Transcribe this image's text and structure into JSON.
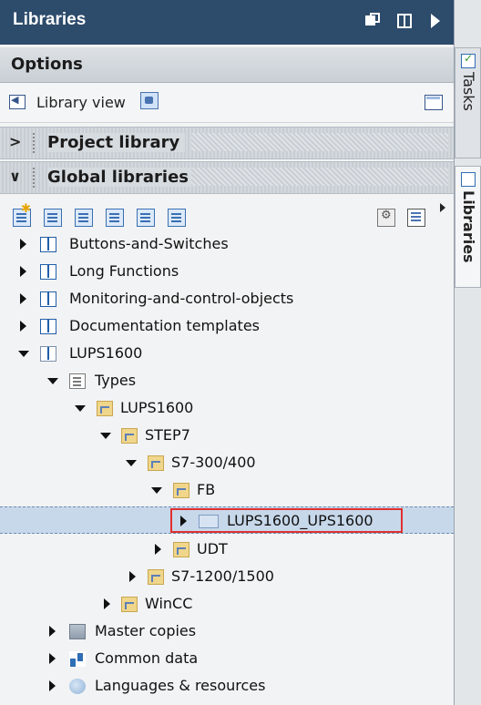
{
  "panel": {
    "title": "Libraries",
    "options_label": "Options",
    "library_view_label": "Library view",
    "project_library_label": "Project library",
    "global_libraries_label": "Global libraries"
  },
  "tree": [
    {
      "label": "Buttons-and-Switches"
    },
    {
      "label": "Long Functions"
    },
    {
      "label": "Monitoring-and-control-objects"
    },
    {
      "label": "Documentation templates"
    },
    {
      "label": "LUPS1600"
    },
    {
      "label": "Types"
    },
    {
      "label": "LUPS1600"
    },
    {
      "label": "STEP7"
    },
    {
      "label": "S7-300/400"
    },
    {
      "label": "FB"
    },
    {
      "label": "LUPS1600_UPS1600"
    },
    {
      "label": "UDT"
    },
    {
      "label": "S7-1200/1500"
    },
    {
      "label": "WinCC"
    },
    {
      "label": "Master copies"
    },
    {
      "label": "Common data"
    },
    {
      "label": "Languages & resources"
    }
  ],
  "right_tabs": {
    "tasks": "Tasks",
    "libraries": "Libraries"
  },
  "colors": {
    "title_bar": "#2d4b6b",
    "selection": "#c7d8ea",
    "highlight_border": "#e03030"
  }
}
